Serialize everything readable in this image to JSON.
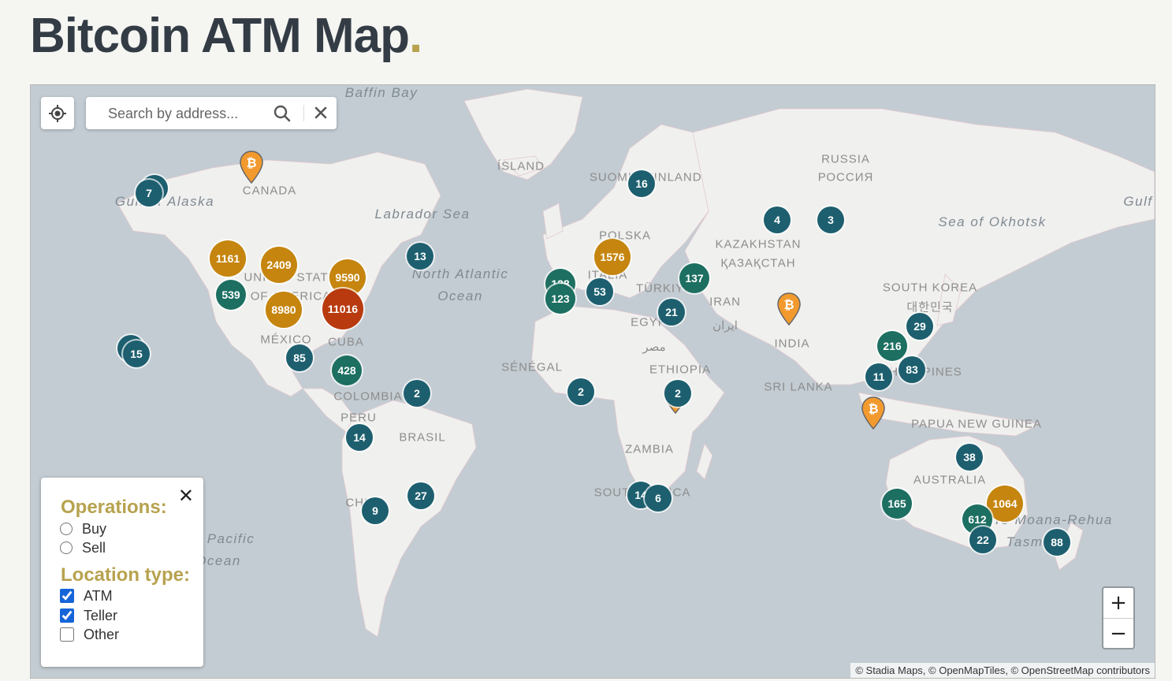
{
  "page": {
    "title": "Bitcoin ATM Map",
    "title_dot": ".",
    "colors": {
      "title": "#333c45",
      "accent": "#b7a24f",
      "water": "#c3ccd2",
      "land": "#f0f0ef",
      "cluster_small": "#1d5f6f",
      "cluster_medium": "#1c6f61",
      "cluster_large": "#c5850e",
      "cluster_xlarge": "#b83a0e",
      "pin": "#f29a2e"
    }
  },
  "search": {
    "placeholder": "Search by address...",
    "search_icon": "search-icon",
    "clear_icon": "close-icon"
  },
  "locate": {
    "icon": "crosshair-icon"
  },
  "filters": {
    "close_label": "✕",
    "operations_heading": "Operations:",
    "operations": [
      {
        "label": "Buy",
        "checked": false
      },
      {
        "label": "Sell",
        "checked": false
      }
    ],
    "location_heading": "Location type:",
    "location_types": [
      {
        "label": "ATM",
        "checked": true
      },
      {
        "label": "Teller",
        "checked": true
      },
      {
        "label": "Other",
        "checked": false
      }
    ]
  },
  "zoom": {
    "in_label": "+",
    "out_label": "−"
  },
  "attribution": "© Stadia Maps, © OpenMapTiles, © OpenStreetMap contributors",
  "labels": {
    "baffin_bay": "Baffin Bay",
    "island": "ÍSLAND",
    "suomi": "SUOMI",
    "finland": "FINLAND",
    "russia": "RUSSIA",
    "rossiya": "РОССИЯ",
    "gulf_alaska": "Gulf of Alaska",
    "canada": "CANADA",
    "labrador_sea": "Labrador Sea",
    "sea_okhotsk": "Sea of Okhotsk",
    "gulf_right": "Gulf",
    "kazakhstan": "KAZAKHSTAN",
    "kazakhstan_local": "ҚАЗАҚСТАН",
    "polska": "POLSKA",
    "united_states": "UNITED STATES",
    "of_america": "OF AMERICA",
    "north_atlantic": "North Atlantic",
    "ocean": "Ocean",
    "italia": "ITALIA",
    "turkiye": "TÜRKIYE",
    "south_korea": "SOUTH KOREA",
    "korea_local": "대한민국",
    "iran": "IRAN",
    "iran_local": "ایران",
    "egypt": "EGYPT",
    "egypt_local": "مصر",
    "mexico": "MÉXICO",
    "cuba": "CUBA",
    "india": "INDIA",
    "senegal": "SÉNÉGAL",
    "ethiopia": "ETHIOPIA",
    "philippines": "PHILIPPINES",
    "sri_lanka": "SRI LANKA",
    "colombia": "COLOMBIA",
    "peru": "PERU",
    "brasil": "BRASIL",
    "papua": "PAPUA NEW GUINEA",
    "zambia": "ZAMBIA",
    "australia": "AUSTRALIA",
    "south_africa": "SOUTH AFRICA",
    "chile": "CHILE",
    "tasman": "Tasman",
    "pacific": "Pacific",
    "ocean_left": "Ocean",
    "te_rehua": "Te Moana-Rehua"
  },
  "clusters": [
    {
      "count": "7",
      "size": "s"
    },
    {
      "count": "1161",
      "size": "l"
    },
    {
      "count": "2409",
      "size": "l"
    },
    {
      "count": "9590",
      "size": "l"
    },
    {
      "count": "539",
      "size": "m"
    },
    {
      "count": "8980",
      "size": "l"
    },
    {
      "count": "11016",
      "size": "xl"
    },
    {
      "count": "13",
      "size": "s"
    },
    {
      "count": "15",
      "size": "s"
    },
    {
      "count": "85",
      "size": "s"
    },
    {
      "count": "428",
      "size": "m"
    },
    {
      "count": "2",
      "size": "s"
    },
    {
      "count": "14",
      "size": "s"
    },
    {
      "count": "27",
      "size": "s"
    },
    {
      "count": "9",
      "size": "s"
    },
    {
      "count": "16",
      "size": "s"
    },
    {
      "count": "1576",
      "size": "l"
    },
    {
      "count": "128",
      "size": "m"
    },
    {
      "count": "123",
      "size": "m"
    },
    {
      "count": "53",
      "size": "s"
    },
    {
      "count": "137",
      "size": "m"
    },
    {
      "count": "21",
      "size": "s"
    },
    {
      "count": "4",
      "size": "s"
    },
    {
      "count": "3",
      "size": "s"
    },
    {
      "count": "2",
      "size": "s"
    },
    {
      "count": "2",
      "size": "s"
    },
    {
      "count": "14",
      "size": "s"
    },
    {
      "count": "6",
      "size": "s"
    },
    {
      "count": "29",
      "size": "s"
    },
    {
      "count": "216",
      "size": "m"
    },
    {
      "count": "11",
      "size": "s"
    },
    {
      "count": "83",
      "size": "s"
    },
    {
      "count": "38",
      "size": "s"
    },
    {
      "count": "165",
      "size": "m"
    },
    {
      "count": "1064",
      "size": "l"
    },
    {
      "count": "612",
      "size": "m"
    },
    {
      "count": "22",
      "size": "s"
    },
    {
      "count": "88",
      "size": "s"
    }
  ],
  "pins": [
    {
      "icon": "bitcoin-pin-icon"
    },
    {
      "icon": "bitcoin-pin-icon"
    },
    {
      "icon": "bitcoin-pin-icon"
    },
    {
      "icon": "bitcoin-pin-icon"
    }
  ]
}
